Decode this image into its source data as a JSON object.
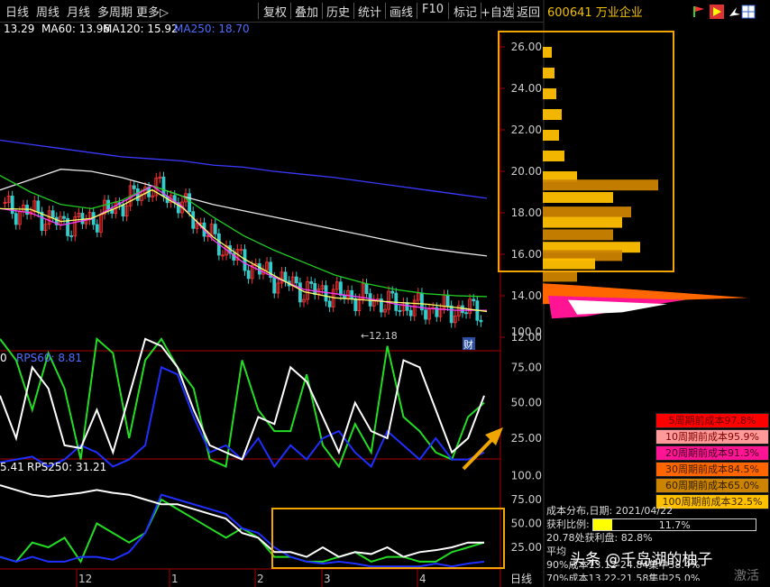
{
  "toolbar": {
    "left": [
      "日线",
      "周线",
      "月线",
      "多周期",
      "更多▷"
    ],
    "right": [
      "复权",
      "叠加",
      "历史",
      "统计",
      "画线",
      "F10",
      "标记",
      "+自选",
      "返回"
    ]
  },
  "stock": "600641 万业企业",
  "ma_row": [
    {
      "text": "13.29",
      "color": "#ffffff"
    },
    {
      "text": "MA60: 13.96",
      "color": "#ffffff"
    },
    {
      "text": "MA120: 15.92",
      "color": "#ffffff"
    },
    {
      "text": "MA250: 18.70",
      "color": "#4f6dff"
    }
  ],
  "price_axis": [
    "26.00",
    "24.00",
    "22.00",
    "20.00",
    "18.00",
    "16.00",
    "14.00",
    "12.00"
  ],
  "low_marker": "12.18",
  "cai_badge": "财",
  "rps60_title": "RPS60: 8.81",
  "rps60_left": "0",
  "rps250_title": "RPS250: 31.21",
  "rps250_left": "5.41",
  "rps_axis": [
    "100.0",
    "75.00",
    "50.00",
    "25.00"
  ],
  "months": [
    "12",
    "1",
    "2",
    "3",
    "4"
  ],
  "day_label": "日线",
  "legend": [
    {
      "text": "5周期前成本97.8%",
      "bg": "#ff0000",
      "fg": "#660000"
    },
    {
      "text": "10周期前成本95.9%",
      "bg": "#ff9a9a",
      "fg": "#800000"
    },
    {
      "text": "20周期前成本91.3%",
      "bg": "#ff1493",
      "fg": "#400020"
    },
    {
      "text": "30周期前成本84.5%",
      "bg": "#ff6600",
      "fg": "#402000"
    },
    {
      "text": "60周期前成本65.0%",
      "bg": "#cc8400",
      "fg": "#301e00"
    },
    {
      "text": "100周期前成本32.5%",
      "bg": "#ffc000",
      "fg": "#402800"
    }
  ],
  "info": {
    "date_label": "成本分布,日期:",
    "date": "2021/04/22",
    "profit_label": "获利比例:",
    "profit_pct": 11.7,
    "profit_text": "11.7%",
    "line3": "20.78处获利盘: 82.8%",
    "line4": "平均",
    "line5": "90%成本13.12-24.84集中38.4%",
    "line6": "70%成本13.22-21.58集中25.0%"
  },
  "watermark": "头条 @千岛湖的柚子",
  "watermark2": "激活",
  "colors": {
    "ma250": "#3a3aff",
    "ma120": "#e8e8e8",
    "ma60": "#22cc22",
    "ma20": "#ff3dff",
    "ma10": "#ffff66",
    "up": "#ff3333",
    "down": "#33cccc",
    "rps_white": "#ffffff",
    "rps_green": "#22dd22",
    "rps_blue": "#1f2fff",
    "frame": "#f0a500",
    "axis": "#aa0000"
  },
  "chart_data": {
    "type": "line",
    "y_axis_price": [
      12,
      26
    ],
    "ma250": [
      21.5,
      21.3,
      21.1,
      20.9,
      20.7,
      20.6,
      20.5,
      20.3,
      20.2,
      20.0,
      19.85,
      19.7,
      19.5,
      19.3,
      19.1,
      18.9,
      18.7
    ],
    "ma120": [
      19.1,
      19.6,
      20.1,
      20.0,
      19.7,
      19.3,
      18.8,
      18.4,
      18.1,
      17.8,
      17.5,
      17.2,
      16.9,
      16.6,
      16.3,
      16.1,
      15.92
    ],
    "ma60": [
      19.8,
      19.0,
      18.4,
      18.2,
      18.6,
      19.3,
      18.8,
      17.8,
      16.9,
      16.2,
      15.6,
      15.0,
      14.6,
      14.3,
      14.1,
      14.0,
      13.96
    ],
    "ma20": [
      18.2,
      18.0,
      17.4,
      17.7,
      18.5,
      19.3,
      18.3,
      16.7,
      15.6,
      14.9,
      14.3,
      14.1,
      13.9,
      13.6,
      13.4,
      13.3,
      13.3
    ],
    "rps60_white": [
      55,
      25,
      75,
      60,
      20,
      18,
      45,
      15,
      55,
      95,
      90,
      75,
      45,
      20,
      15,
      10,
      40,
      35,
      75,
      65,
      40,
      15,
      50,
      30,
      25,
      80,
      75,
      45,
      15,
      25,
      55
    ],
    "rps60_green": [
      95,
      80,
      45,
      85,
      60,
      10,
      95,
      85,
      25,
      80,
      95,
      75,
      60,
      10,
      5,
      80,
      45,
      30,
      30,
      70,
      20,
      5,
      35,
      15,
      90,
      40,
      30,
      15,
      10,
      40,
      50
    ],
    "rps60_blue": [
      8,
      10,
      12,
      5,
      10,
      20,
      15,
      5,
      10,
      20,
      75,
      70,
      40,
      15,
      20,
      10,
      25,
      5,
      20,
      10,
      25,
      30,
      15,
      5,
      30,
      20,
      10,
      25,
      10,
      10,
      15
    ],
    "rps250_white": [
      90,
      85,
      80,
      78,
      80,
      82,
      85,
      82,
      80,
      75,
      70,
      70,
      65,
      60,
      55,
      40,
      35,
      20,
      20,
      15,
      25,
      15,
      20,
      18,
      25,
      15,
      20,
      22,
      25,
      30,
      30
    ],
    "rps250_green": [
      15,
      10,
      30,
      25,
      35,
      10,
      50,
      40,
      30,
      40,
      75,
      65,
      55,
      45,
      35,
      45,
      35,
      15,
      15,
      10,
      10,
      15,
      20,
      10,
      15,
      15,
      10,
      10,
      20,
      25,
      30
    ],
    "rps250_blue": [
      15,
      10,
      15,
      10,
      10,
      15,
      15,
      12,
      20,
      40,
      80,
      75,
      70,
      65,
      60,
      45,
      40,
      25,
      15,
      10,
      8,
      10,
      8,
      5,
      5,
      5,
      5,
      8,
      5,
      8,
      10
    ]
  }
}
